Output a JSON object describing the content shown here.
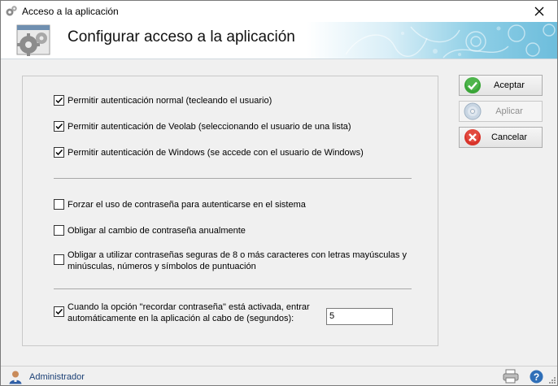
{
  "window": {
    "title": "Acceso a la aplicación"
  },
  "banner": {
    "heading": "Configurar acceso a la aplicación"
  },
  "options": {
    "auth_normal": {
      "label": "Permitir autenticación normal (tecleando el usuario)",
      "checked": true
    },
    "auth_veolab": {
      "label": "Permitir autenticación de Veolab (seleccionando el usuario de una lista)",
      "checked": true
    },
    "auth_windows": {
      "label": "Permitir autenticación de Windows (se accede con el usuario de Windows)",
      "checked": true
    },
    "force_password": {
      "label": "Forzar el uso de contraseña para autenticarse en el sistema",
      "checked": false
    },
    "yearly_change": {
      "label": "Obligar al cambio de contraseña anualmente",
      "checked": false
    },
    "strong_password": {
      "label_line1": "Obligar a utilizar contraseñas seguras de 8 o más caracteres con letras mayúsculas y",
      "label_line2": "minúsculas, números y símbolos de puntuación",
      "checked": false
    },
    "auto_login": {
      "label_line1": "Cuando la opción \"recordar contraseña\" está activada, entrar",
      "label_line2": "automáticamente en la aplicación al cabo de (segundos):",
      "checked": true,
      "seconds": "5"
    }
  },
  "buttons": {
    "accept": "Aceptar",
    "apply": "Aplicar",
    "cancel": "Cancelar"
  },
  "status": {
    "user": "Administrador"
  },
  "colors": {
    "accept_icon": "#3aa538",
    "cancel_icon": "#d8332a",
    "status_text": "#1a3f75",
    "help_icon": "#2f6fb8"
  }
}
